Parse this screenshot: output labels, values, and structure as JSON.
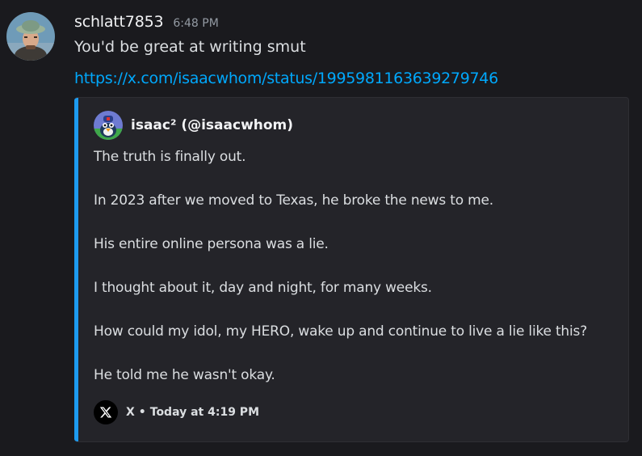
{
  "message": {
    "username": "schlatt7853",
    "timestamp": "6:48 PM",
    "content": "You'd be great at writing smut",
    "link": "https://x.com/isaacwhom/status/1995981163639279746"
  },
  "embed": {
    "author": "isaac² (@isaacwhom)",
    "lines": [
      "The truth is finally out.",
      "In 2023 after we moved to Texas, he broke the news to me.",
      "His entire online persona was a lie.",
      "I thought about it, day and night, for many weeks.",
      "How could my idol, my HERO, wake up and continue to live a lie like this?",
      "He told me he wasn't okay."
    ],
    "footer_source": "X",
    "footer_separator": "•",
    "footer_time": "Today at 4:19 PM",
    "accent_color": "#1d9bf0"
  },
  "icons": {
    "footer": "x-logo-icon"
  }
}
